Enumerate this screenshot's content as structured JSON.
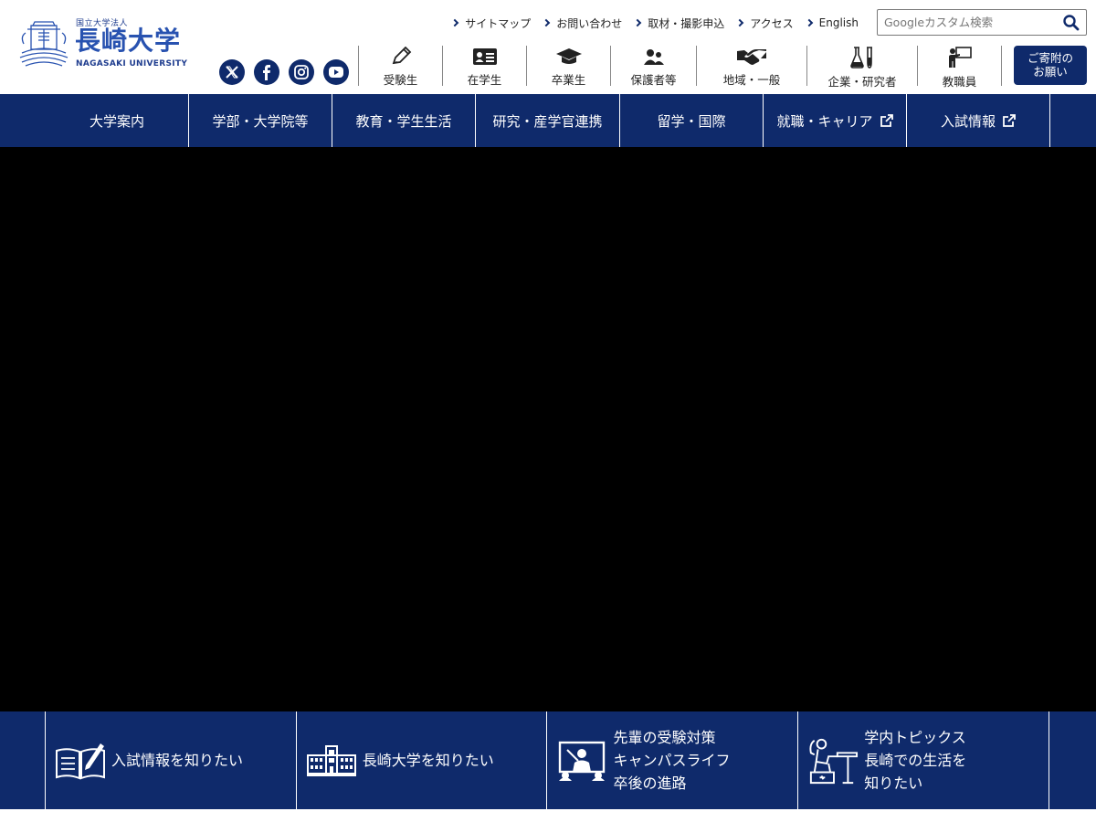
{
  "logo": {
    "small": "国立大学法人",
    "main": "長崎大学",
    "english": "NAGASAKI UNIVERSITY"
  },
  "util_links": [
    "サイトマップ",
    "お問い合わせ",
    "取材・撮影申込",
    "アクセス",
    "English"
  ],
  "search": {
    "placeholder": "Googleカスタム検索"
  },
  "social": [
    "x-icon",
    "facebook-icon",
    "instagram-icon",
    "youtube-icon"
  ],
  "audience": [
    {
      "label": "受験生",
      "icon": "pencil-icon"
    },
    {
      "label": "在学生",
      "icon": "student-card-icon"
    },
    {
      "label": "卒業生",
      "icon": "graduation-cap-icon"
    },
    {
      "label": "保護者等",
      "icon": "parents-icon"
    },
    {
      "label": "地域・一般",
      "icon": "handshake-icon"
    },
    {
      "label": "企業・研究者",
      "icon": "flask-icon"
    },
    {
      "label": "教職員",
      "icon": "teacher-icon"
    }
  ],
  "donate": {
    "label": "ご寄附の\nお願い"
  },
  "gnav": [
    {
      "label": "大学案内",
      "external": false
    },
    {
      "label": "学部・大学院等",
      "external": false
    },
    {
      "label": "教育・学生生活",
      "external": false
    },
    {
      "label": "研究・産学官連携",
      "external": false
    },
    {
      "label": "留学・国際",
      "external": false
    },
    {
      "label": "就職・キャリア",
      "external": true
    },
    {
      "label": "入試情報",
      "external": true
    }
  ],
  "quick_links": [
    {
      "label": "入試情報を知りたい",
      "icon": "open-book-icon"
    },
    {
      "label": "長崎大学を知りたい",
      "icon": "campus-building-icon"
    },
    {
      "label": "先輩の受験対策\nキャンパスライフ\n卒後の進路",
      "icon": "presentation-icon"
    },
    {
      "label": "学内トピックス\n長崎での生活を\n知りたい",
      "icon": "statue-icon"
    }
  ],
  "colors": {
    "navy": "#0f2a6b",
    "logo_blue": "#2852b0"
  }
}
